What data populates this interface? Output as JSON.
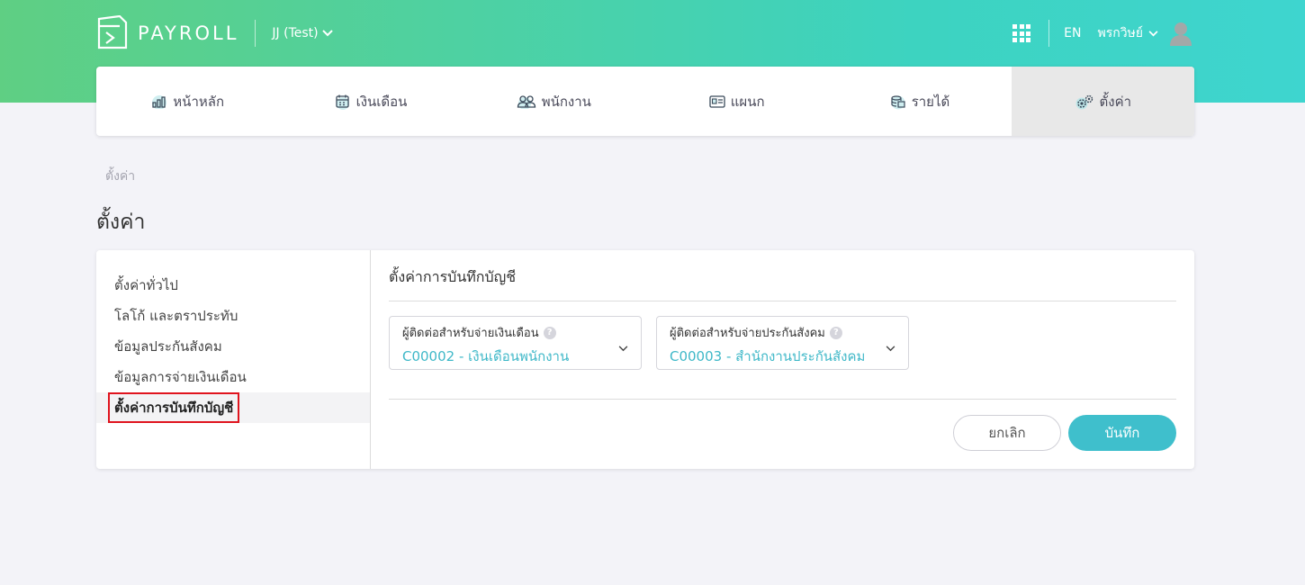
{
  "header": {
    "logo_text": "PAYROLL",
    "company": "JJ (Test)",
    "language": "EN",
    "user_name": "พรกวิษย์"
  },
  "nav": {
    "items": [
      {
        "label": "หน้าหลัก",
        "icon": "bar-chart-icon"
      },
      {
        "label": "เงินเดือน",
        "icon": "calendar-icon"
      },
      {
        "label": "พนักงาน",
        "icon": "people-icon"
      },
      {
        "label": "แผนก",
        "icon": "id-card-icon"
      },
      {
        "label": "รายได้",
        "icon": "money-icon"
      },
      {
        "label": "ตั้งค่า",
        "icon": "gears-icon",
        "active": true
      }
    ]
  },
  "breadcrumb": "ตั้งค่า",
  "page_title": "ตั้งค่า",
  "sidebar": {
    "items": [
      {
        "label": "ตั้งค่าทั่วไป"
      },
      {
        "label": "โลโก้ และตราประทับ"
      },
      {
        "label": "ข้อมูลประกันสังคม"
      },
      {
        "label": "ข้อมูลการจ่ายเงินเดือน"
      },
      {
        "label": "ตั้งค่าการบันทึกบัญชี",
        "active": true
      }
    ]
  },
  "content": {
    "title": "ตั้งค่าการบันทึกบัญชี",
    "fields": [
      {
        "label": "ผู้ติดต่อสำหรับจ่ายเงินเดือน",
        "value": "C00002 - เงินเดือนพนักงาน"
      },
      {
        "label": "ผู้ติดต่อสำหรับจ่ายประกันสังคม",
        "value": "C00003 - สำนักงานประกันสังคม"
      }
    ],
    "cancel_label": "ยกเลิก",
    "save_label": "บันทึก"
  },
  "colors": {
    "accent": "#3fbfcc",
    "header_gradient_start": "#5fcf83",
    "header_gradient_end": "#3ed5cf",
    "highlight_border": "#e0141e"
  }
}
